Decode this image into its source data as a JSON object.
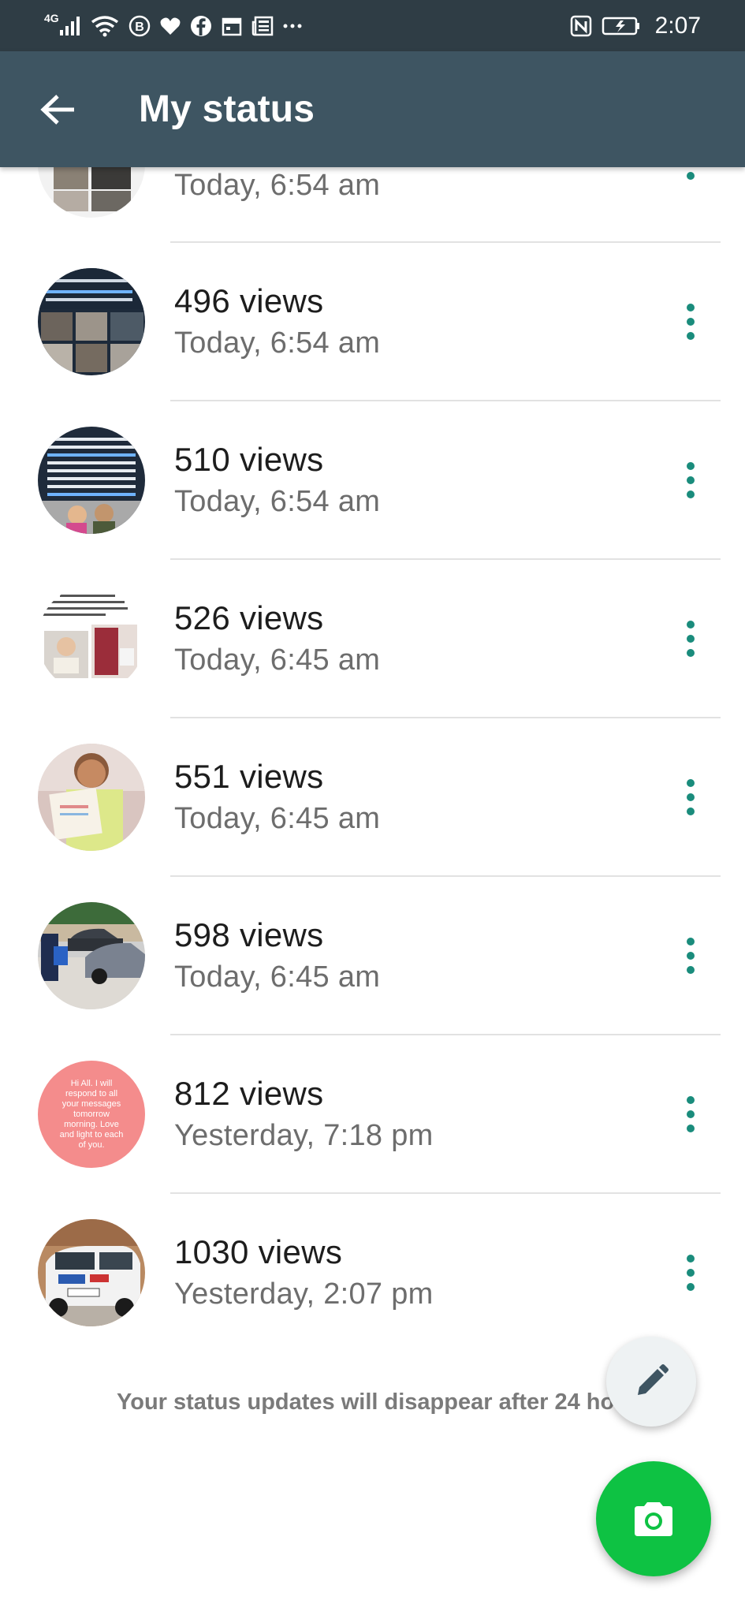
{
  "status_bar": {
    "network": "4G",
    "time": "2:07",
    "icons": [
      "signal-icon",
      "wifi-icon",
      "b-badge-icon",
      "heart-icon",
      "facebook-icon",
      "calendar-icon",
      "news-icon",
      "more-icon",
      "nfc-icon",
      "battery-charging-icon"
    ]
  },
  "app_bar": {
    "title": "My status",
    "back_icon": "arrow-left-icon"
  },
  "statuses": [
    {
      "views": "",
      "time": "Today, 6:54 am"
    },
    {
      "views": "496 views",
      "time": "Today, 6:54 am"
    },
    {
      "views": "510 views",
      "time": "Today, 6:54 am"
    },
    {
      "views": "526 views",
      "time": "Today, 6:45 am"
    },
    {
      "views": "551 views",
      "time": "Today, 6:45 am"
    },
    {
      "views": "598 views",
      "time": "Today, 6:45 am"
    },
    {
      "views": "812 views",
      "time": "Yesterday, 7:18 pm"
    },
    {
      "views": "1030 views",
      "time": "Yesterday, 2:07 pm"
    }
  ],
  "pink_status_text": "Hi All. I will respond to all your messages tomorrow morning. Love and light to each of you.",
  "footer_note": "Your status updates will disappear after 24 hou",
  "fabs": {
    "pencil_icon": "pencil-icon",
    "camera_icon": "camera-icon"
  },
  "colors": {
    "status_bar": "#2f3d45",
    "app_bar": "#3e5562",
    "menu_dots": "#1a8c7c",
    "camera_fab": "#0ec243",
    "pink_status": "#f48c8c"
  }
}
